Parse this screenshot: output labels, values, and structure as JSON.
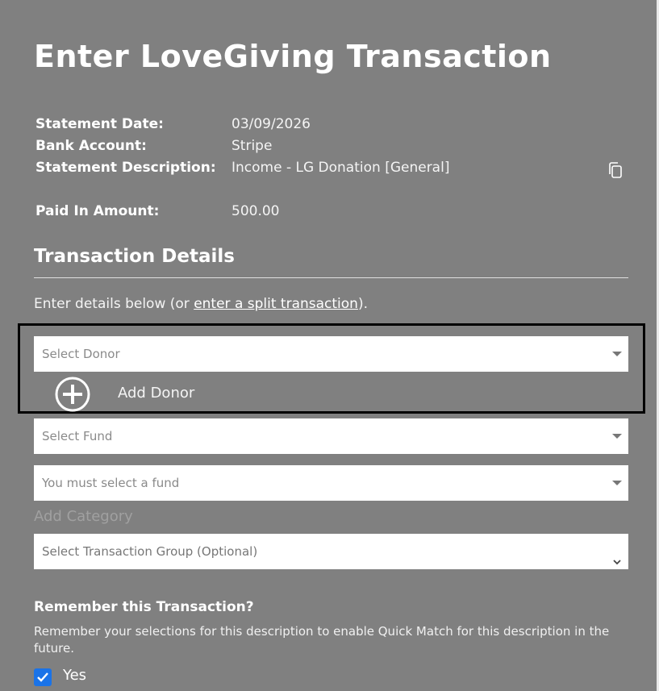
{
  "page": {
    "title": "Enter LoveGiving Transaction"
  },
  "statement": {
    "date_label": "Statement Date:",
    "date_value": "03/09/2026",
    "account_label": "Bank Account:",
    "account_value": "Stripe",
    "description_label": "Statement Description:",
    "description_value": "Income - LG Donation [General]",
    "amount_label": "Paid In Amount:",
    "amount_value": "500.00"
  },
  "details": {
    "heading": "Transaction Details",
    "intro_prefix": "Enter details below (or ",
    "split_link": "enter a split transaction",
    "intro_suffix": ")."
  },
  "form": {
    "donor_placeholder": "Select Donor",
    "add_donor_label": "Add Donor",
    "fund_placeholder": "Select Fund",
    "subfund_placeholder": "You must select a fund",
    "add_category_label": "Add Category",
    "group_placeholder": "Select Transaction Group (Optional)"
  },
  "remember": {
    "heading": "Remember this Transaction?",
    "description": "Remember your selections for this description to enable Quick Match for this description in the future.",
    "yes_label": "Yes",
    "checked": true
  },
  "icons": {
    "copy": "copy-icon",
    "add": "plus-circle-icon",
    "dropdown": "caret-down-icon",
    "chevron": "chevron-down-icon",
    "check": "checkmark-icon"
  },
  "colors": {
    "background": "#808080",
    "checkbox": "#1a73e8",
    "highlight_border": "#000000"
  }
}
